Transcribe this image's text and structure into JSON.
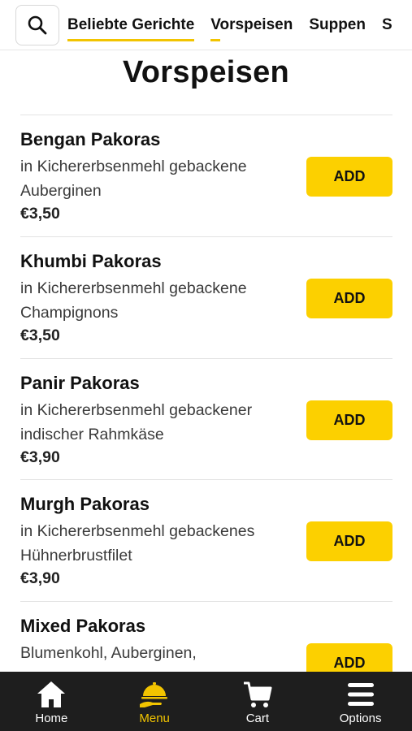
{
  "header": {
    "search_icon": "search-icon",
    "tabs": [
      {
        "label": "Beliebte Gerichte"
      },
      {
        "label": "Vorspeisen"
      },
      {
        "label": "Suppen"
      },
      {
        "label": "S"
      }
    ]
  },
  "page_title": "Vorspeisen",
  "items": [
    {
      "name": "Bengan Pakoras",
      "desc1": "in Kichererbsenmehl gebackene",
      "desc2": "Auberginen",
      "price": "€3,50",
      "button": "ADD"
    },
    {
      "name": "Khumbi Pakoras",
      "desc1": "in Kichererbsenmehl gebackene",
      "desc2": "Champignons",
      "price": "€3,50",
      "button": "ADD"
    },
    {
      "name": "Panir Pakoras",
      "desc1": "in Kichererbsenmehl gebackener",
      "desc2": "indischer Rahmkäse",
      "price": "€3,90",
      "button": "ADD"
    },
    {
      "name": "Murgh Pakoras",
      "desc1": "in Kichererbsenmehl gebackenes",
      "desc2": "Hühnerbrustfilet",
      "price": "€3,90",
      "button": "ADD"
    },
    {
      "name": "Mixed Pakoras",
      "desc1": "Blumenkohl, Auberginen,",
      "desc2": "",
      "price": "",
      "button": "ADD"
    }
  ],
  "nav": [
    {
      "label": "Home",
      "icon": "home-icon"
    },
    {
      "label": "Menu",
      "icon": "menu-serving-icon"
    },
    {
      "label": "Cart",
      "icon": "cart-icon"
    },
    {
      "label": "Options",
      "icon": "hamburger-icon"
    }
  ],
  "colors": {
    "accent": "#fcd000",
    "nav_bg": "#1e1e1e",
    "active": "#f2c400"
  }
}
